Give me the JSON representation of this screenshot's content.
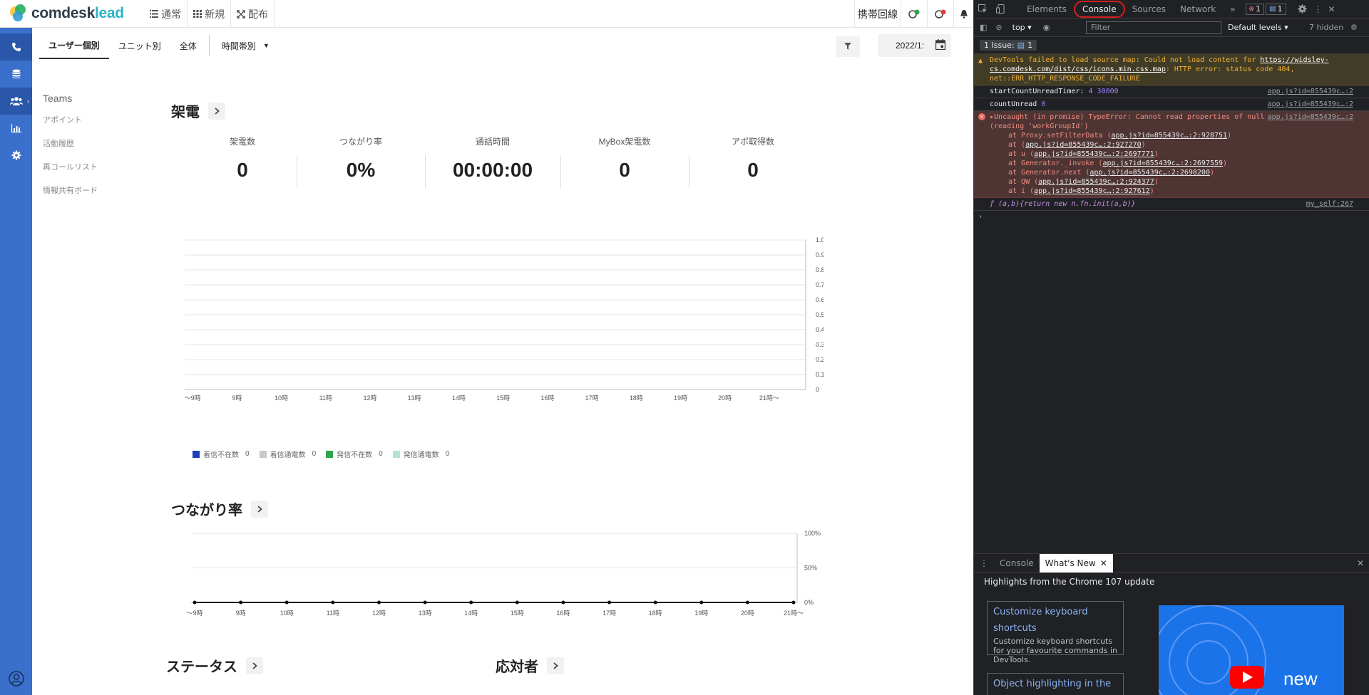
{
  "app": {
    "logo": {
      "brand": "comdesk",
      "product": "lead"
    },
    "topnav": [
      {
        "label": "通常",
        "icon": "list-icon"
      },
      {
        "label": "新規",
        "icon": "grid-icon"
      },
      {
        "label": "配布",
        "icon": "distribute-icon"
      }
    ],
    "topright": {
      "mobile_label": "携帯回線"
    },
    "subtabs": [
      "ユーザー個別",
      "ユニット別",
      "全体"
    ],
    "time_dropdown": "時間帯別",
    "date_value": "2022/1:",
    "sidemenu": {
      "title": "Teams",
      "items": [
        "アポイント",
        "活動履歴",
        "再コールリスト",
        "情報共有ボード"
      ]
    },
    "calls_section": {
      "title": "架電",
      "stats": [
        {
          "label": "架電数",
          "value": "0"
        },
        {
          "label": "つながり率",
          "value": "0%"
        },
        {
          "label": "通話時間",
          "value": "00:00:00"
        },
        {
          "label": "MyBox架電数",
          "value": "0"
        },
        {
          "label": "アポ取得数",
          "value": "0"
        }
      ]
    },
    "connection_section": {
      "title": "つながり率"
    },
    "status_section": {
      "title": "ステータス"
    },
    "responder_section": {
      "title": "応対者"
    }
  },
  "chart_data": [
    {
      "type": "bar",
      "categories": [
        "〜9時",
        "9時",
        "10時",
        "11時",
        "12時",
        "13時",
        "14時",
        "15時",
        "16時",
        "17時",
        "18時",
        "19時",
        "20時",
        "21時〜"
      ],
      "series": [
        {
          "name": "着信不在数",
          "values": [
            0,
            0,
            0,
            0,
            0,
            0,
            0,
            0,
            0,
            0,
            0,
            0,
            0,
            0
          ],
          "color": "#1f3fbf",
          "total": "0"
        },
        {
          "name": "着信通電数",
          "values": [
            0,
            0,
            0,
            0,
            0,
            0,
            0,
            0,
            0,
            0,
            0,
            0,
            0,
            0
          ],
          "color": "#c8c8c8",
          "total": "0"
        },
        {
          "name": "発信不在数",
          "values": [
            0,
            0,
            0,
            0,
            0,
            0,
            0,
            0,
            0,
            0,
            0,
            0,
            0,
            0
          ],
          "color": "#2ea44f",
          "total": "0"
        },
        {
          "name": "発信通電数",
          "values": [
            0,
            0,
            0,
            0,
            0,
            0,
            0,
            0,
            0,
            0,
            0,
            0,
            0,
            0
          ],
          "color": "#b7e3cf",
          "total": "0"
        }
      ],
      "ylim": [
        0,
        1.0
      ],
      "yticks": [
        "0",
        "0.1",
        "0.2",
        "0.3",
        "0.4",
        "0.5",
        "0.6",
        "0.7",
        "0.8",
        "0.9",
        "1.0"
      ],
      "grid": true,
      "legend": "bottom-left"
    },
    {
      "type": "line",
      "categories": [
        "〜9時",
        "9時",
        "10時",
        "11時",
        "12時",
        "13時",
        "14時",
        "15時",
        "16時",
        "17時",
        "18時",
        "19時",
        "20時",
        "21時〜"
      ],
      "values": [
        0,
        0,
        0,
        0,
        0,
        0,
        0,
        0,
        0,
        0,
        0,
        0,
        0,
        0
      ],
      "ylim": [
        0,
        100
      ],
      "yticks": [
        "0%",
        "50%",
        "100%"
      ],
      "grid": true
    }
  ],
  "devtools": {
    "tabs": [
      "Elements",
      "Console",
      "Sources",
      "Network"
    ],
    "active_tab": "Console",
    "error_count": "1",
    "message_count": "1",
    "context": "top",
    "filter_placeholder": "Filter",
    "levels": "Default levels",
    "hidden": "7 hidden",
    "issues_label": "1 Issue:",
    "issues_count": "1",
    "messages": {
      "warn_text": "DevTools failed to load source map: Could not load content for ",
      "warn_link": "https://widsley-cs.comdesk.com/dist/css/icons.min.css.map",
      "warn_tail": ": HTTP error: status code 404, net::ERR_HTTP_RESPONSE_CODE_FAILURE",
      "log1": "startCountUnreadTimer:",
      "log1_a": "4",
      "log1_b": "30000",
      "log1_src": "app.js?id=855439c…:2",
      "log2": "countUnread",
      "log2_a": "0",
      "log2_src": "app.js?id=855439c…:2",
      "err_head": "Uncaught (in promise) TypeError: Cannot read properties of null (reading 'workGroupId')",
      "err_src": "app.js?id=855439c…:2",
      "stack": [
        {
          "fn": "at Proxy.setFilterData",
          "link": "app.js?id=855439c…:2:928751"
        },
        {
          "fn": "at",
          "link": "app.js?id=855439c…:2:927270"
        },
        {
          "fn": "at u",
          "link": "app.js?id=855439c…:2:2697771"
        },
        {
          "fn": "at Generator._invoke",
          "link": "app.js?id=855439c…:2:2697559"
        },
        {
          "fn": "at Generator.next",
          "link": "app.js?id=855439c…:2:2698200"
        },
        {
          "fn": "at QW",
          "link": "app.js?id=855439c…:2:924377"
        },
        {
          "fn": "at i",
          "link": "app.js?id=855439c…:2:927612"
        }
      ],
      "fn_line": "ƒ (a,b){return new n.fn.init(a,b)}",
      "fn_src": "my_self:267"
    },
    "drawer": {
      "tabs": [
        "Console",
        "What's New"
      ],
      "heading": "Highlights from the Chrome 107 update",
      "card1_title": "Customize keyboard shortcuts",
      "card1_desc": "Customize keyboard shortcuts for your favourite commands in DevTools.",
      "card2_title": "Object highlighting in the",
      "video_text": "new"
    }
  }
}
